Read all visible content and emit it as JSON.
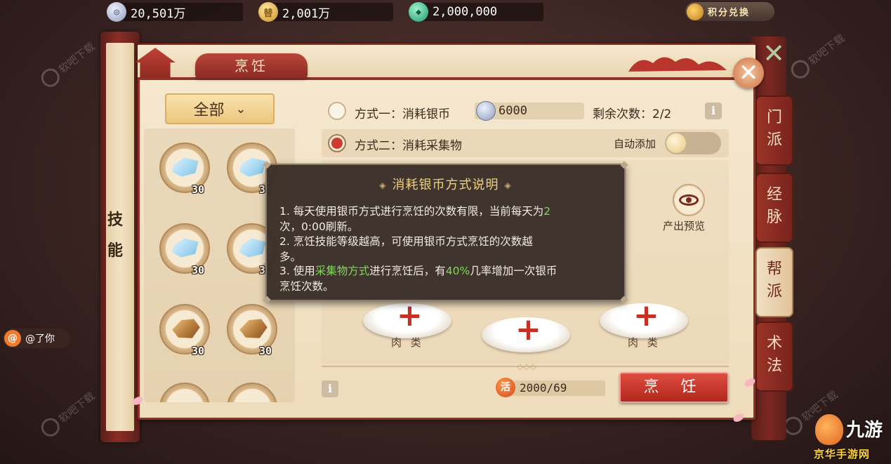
{
  "currency": {
    "silver": {
      "icon": "silver-coin-icon",
      "value": "20,501万"
    },
    "gold": {
      "icon": "gold-coin-icon",
      "glyph": "替",
      "value": "2,001万"
    },
    "jade": {
      "icon": "jade-icon",
      "value": "2,000,000"
    }
  },
  "points_exchange": {
    "label": "积分兑换",
    "icon": "money-bag-icon"
  },
  "watermark": "软吧下载",
  "scroll": {
    "title_chars": [
      "技",
      "能"
    ]
  },
  "panel": {
    "title": "烹饪"
  },
  "category": {
    "selected": "全部"
  },
  "recipes": [
    {
      "kind": "ice",
      "count": "30"
    },
    {
      "kind": "ice",
      "count": "30"
    },
    {
      "kind": "ice",
      "count": "30"
    },
    {
      "kind": "ice",
      "count": "30"
    },
    {
      "kind": "meat",
      "count": "30"
    },
    {
      "kind": "meat",
      "count": "30"
    }
  ],
  "method1": {
    "label": "方式一：消耗银币",
    "cost": "6000",
    "remaining": "剩余次数：2/2",
    "selected": false
  },
  "method2": {
    "label": "方式二：消耗采集物",
    "auto_add_label": "自动添加",
    "auto_add_on": false,
    "selected": true
  },
  "preview": {
    "label": "产出预览"
  },
  "plates": [
    {
      "label": "肉 类"
    },
    {
      "label": ""
    },
    {
      "label": "肉 类"
    }
  ],
  "vitality": {
    "icon_text": "活",
    "value": "2000/69"
  },
  "cook_button": "烹 饪",
  "side_tabs": [
    {
      "chars": [
        "门",
        "派"
      ],
      "active": false
    },
    {
      "chars": [
        "经",
        "脉"
      ],
      "active": false
    },
    {
      "chars": [
        "帮",
        "派"
      ],
      "active": true
    },
    {
      "chars": [
        "术",
        "法"
      ],
      "active": false
    }
  ],
  "tooltip": {
    "title": "消耗银币方式说明",
    "line1_a": "1. 每天使用银币方式进行烹饪的次数有限，当前每天为",
    "line1_hl": "2",
    "line1_b": "次，0:00刷新。",
    "line2": "2. 烹饪技能等级越高，可使用银币方式烹饪的次数越",
    "line2_b": "多。",
    "line3_a": "3. 使用",
    "line3_hl1": "采集物方式",
    "line3_b": "进行烹饪后，有",
    "line3_hl2": "40%",
    "line3_c": "几率增加一次银币",
    "line3_d": "烹饪次数。"
  },
  "chat": {
    "at": "@",
    "text": "@了你"
  },
  "logo": {
    "main": "九游",
    "sub": "京华手游网"
  },
  "colors": {
    "accent_red": "#b3271e",
    "highlight_green": "#7ed957",
    "tooltip_title": "#f0cf7d"
  }
}
